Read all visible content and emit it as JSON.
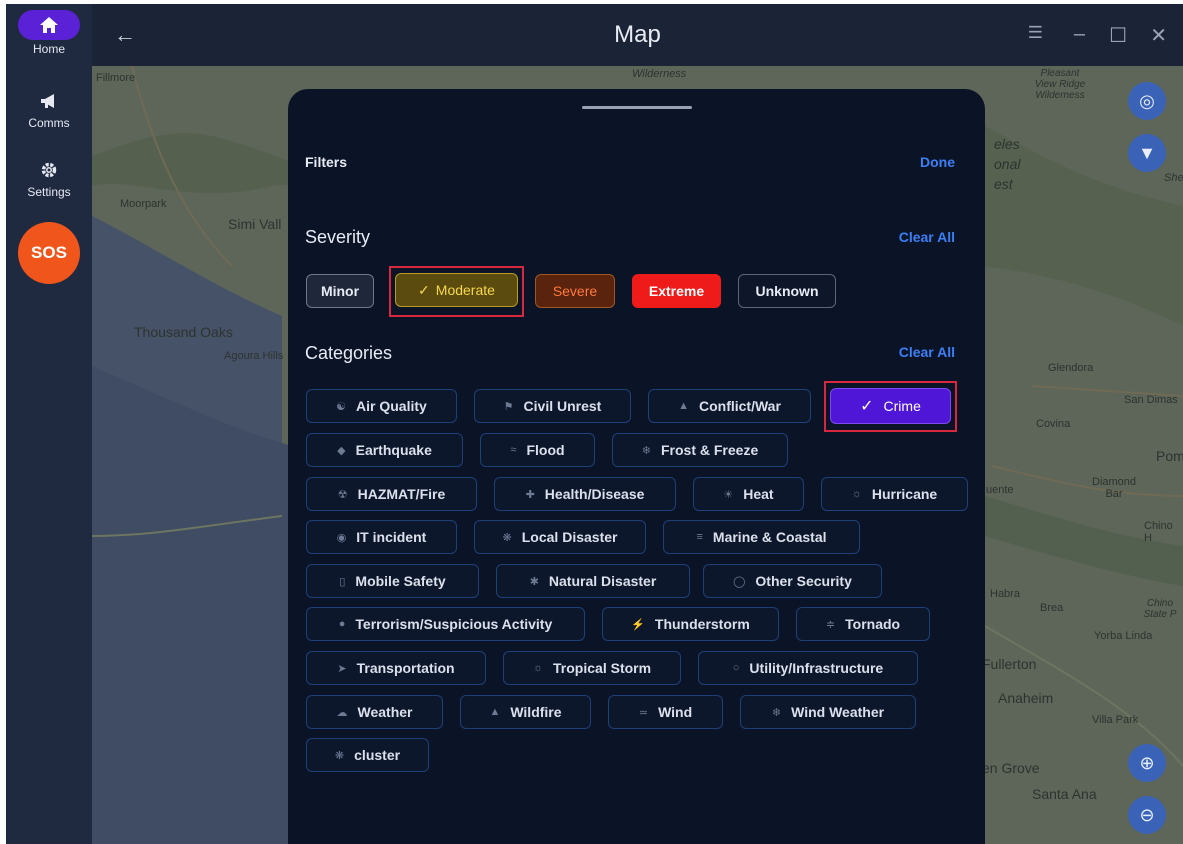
{
  "rail": {
    "home_label": "Home",
    "comms_label": "Comms",
    "settings_label": "Settings",
    "sos_label": "SOS"
  },
  "titlebar": {
    "title": "Map"
  },
  "map": {
    "places": [
      "Fillmore",
      "Moorpark",
      "Simi Vall",
      "Thousand Oaks",
      "Agoura Hills",
      "Wilderness",
      "Pleasant View Ridge Wilderness",
      "eles",
      "onal",
      "est",
      "She",
      "Glendora",
      "San Dimas",
      "Covina",
      "Pom",
      "Diamond Bar",
      "uente",
      "Chino H",
      "Habra",
      "Brea",
      "Chino State P",
      "Yorba Linda",
      "Fullerton",
      "Anaheim",
      "Villa Park",
      "en Grove",
      "Santa Ana"
    ]
  },
  "filters": {
    "title": "Filters",
    "done_label": "Done",
    "severity": {
      "title": "Severity",
      "clear_label": "Clear All",
      "chips": [
        {
          "label": "Minor",
          "selected": false
        },
        {
          "label": "Moderate",
          "selected": true
        },
        {
          "label": "Severe",
          "selected": false
        },
        {
          "label": "Extreme",
          "selected": false
        },
        {
          "label": "Unknown",
          "selected": false
        }
      ]
    },
    "categories": {
      "title": "Categories",
      "clear_label": "Clear All",
      "items": [
        {
          "label": "Air Quality",
          "icon": "air-quality-icon",
          "selected": false
        },
        {
          "label": "Civil Unrest",
          "icon": "civil-unrest-icon",
          "selected": false
        },
        {
          "label": "Conflict/War",
          "icon": "conflict-icon",
          "selected": false
        },
        {
          "label": "Crime",
          "icon": "check-icon",
          "selected": true
        },
        {
          "label": "Earthquake",
          "icon": "earthquake-icon",
          "selected": false
        },
        {
          "label": "Flood",
          "icon": "flood-icon",
          "selected": false
        },
        {
          "label": "Frost & Freeze",
          "icon": "frost-icon",
          "selected": false
        },
        {
          "label": "HAZMAT/Fire",
          "icon": "hazmat-icon",
          "selected": false
        },
        {
          "label": "Health/Disease",
          "icon": "health-icon",
          "selected": false
        },
        {
          "label": "Heat",
          "icon": "heat-icon",
          "selected": false
        },
        {
          "label": "Hurricane",
          "icon": "hurricane-icon",
          "selected": false
        },
        {
          "label": "IT incident",
          "icon": "it-icon",
          "selected": false
        },
        {
          "label": "Local Disaster",
          "icon": "local-disaster-icon",
          "selected": false
        },
        {
          "label": "Marine & Coastal",
          "icon": "marine-icon",
          "selected": false
        },
        {
          "label": "Mobile Safety",
          "icon": "mobile-icon",
          "selected": false
        },
        {
          "label": "Natural Disaster",
          "icon": "natural-disaster-icon",
          "selected": false
        },
        {
          "label": "Other Security",
          "icon": "shield-icon",
          "selected": false
        },
        {
          "label": "Terrorism/Suspicious Activity",
          "icon": "terrorism-icon",
          "selected": false
        },
        {
          "label": "Thunderstorm",
          "icon": "thunderstorm-icon",
          "selected": false
        },
        {
          "label": "Tornado",
          "icon": "tornado-icon",
          "selected": false
        },
        {
          "label": "Transportation",
          "icon": "transportation-icon",
          "selected": false
        },
        {
          "label": "Tropical Storm",
          "icon": "tropical-storm-icon",
          "selected": false
        },
        {
          "label": "Utility/Infrastructure",
          "icon": "utility-icon",
          "selected": false
        },
        {
          "label": "Weather",
          "icon": "weather-icon",
          "selected": false
        },
        {
          "label": "Wildfire",
          "icon": "wildfire-icon",
          "selected": false
        },
        {
          "label": "Wind",
          "icon": "wind-icon",
          "selected": false
        },
        {
          "label": "Wind Weather",
          "icon": "wind-weather-icon",
          "selected": false
        },
        {
          "label": "cluster",
          "icon": "cluster-icon",
          "selected": false
        }
      ]
    }
  },
  "colors": {
    "accent": "#3b7ff5",
    "selected_category": "#4f16d8",
    "sos": "#f0561c",
    "extreme": "#ef1a1a",
    "sheet": "#0b1427"
  }
}
